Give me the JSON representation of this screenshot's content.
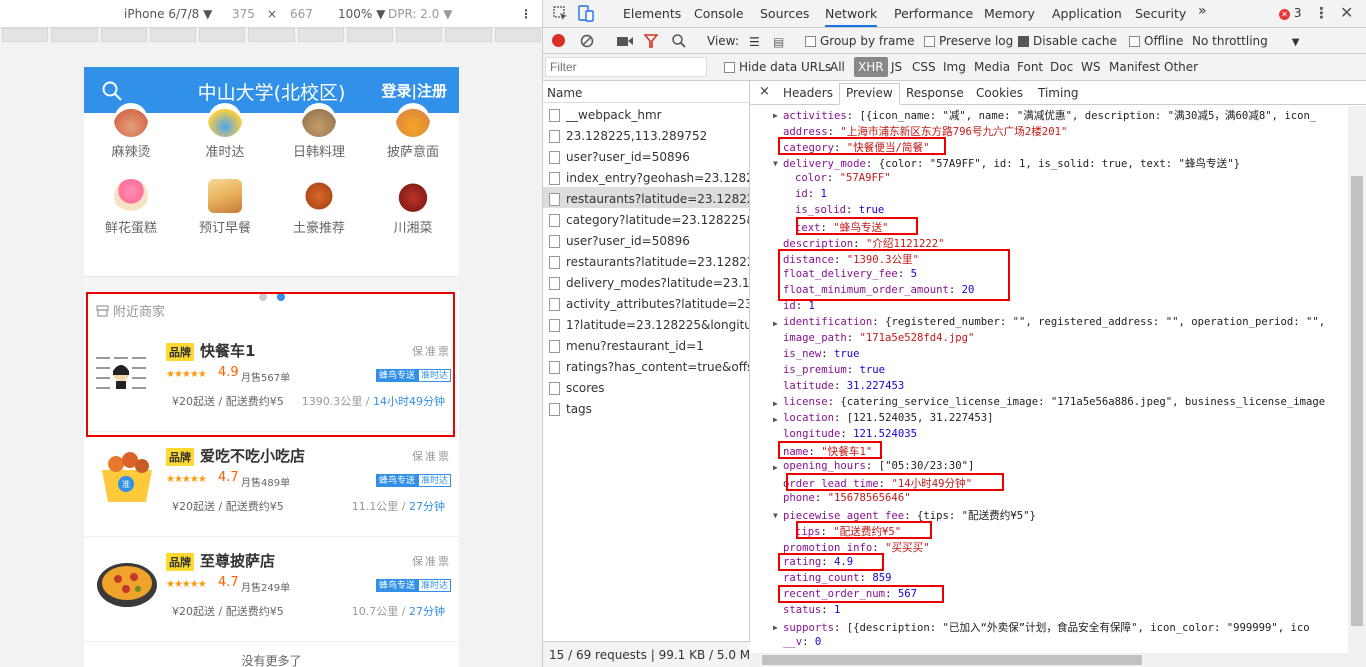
{
  "device_toolbar": {
    "device": "iPhone 6/7/8",
    "width": "375",
    "times": "×",
    "height": "667",
    "zoom": "100%",
    "dpr": "DPR: 2.0"
  },
  "phone": {
    "title": "中山大学(北校区)",
    "login": "登录|注册",
    "food_row1": [
      "麻辣烫",
      "准时达",
      "日韩料理",
      "披萨意面"
    ],
    "food_row2": [
      "鲜花蛋糕",
      "预订早餐",
      "土豪推荐",
      "川湘菜"
    ],
    "nearby_title": "附近商家",
    "brand_label": "品牌",
    "guarantee": "保准票",
    "tag_delivery": "蜂鸟专送",
    "tag_ontime": "准时达",
    "stars": "★★★★★",
    "shops": [
      {
        "name": "快餐车1",
        "rating": "4.9",
        "sold": "月售567单",
        "fee": "¥20起送 / 配送费约¥5",
        "distance": "1390.3公里",
        "time": "14小时49分钟"
      },
      {
        "name": "爱吃不吃小吃店",
        "rating": "4.7",
        "sold": "月售489单",
        "fee": "¥20起送 / 配送费约¥5",
        "distance": "11.1公里",
        "time": "27分钟"
      },
      {
        "name": "至尊披萨店",
        "rating": "4.7",
        "sold": "月售249单",
        "fee": "¥20起送 / 配送费约¥5",
        "distance": "10.7公里",
        "time": "27分钟"
      }
    ],
    "no_more": "没有更多了"
  },
  "devtools": {
    "tabs": [
      "Elements",
      "Console",
      "Sources",
      "Network",
      "Performance",
      "Memory",
      "Application",
      "Security"
    ],
    "more_tabs": "»",
    "error_count": "3",
    "controls": {
      "view": "View:",
      "group_by_frame": "Group by frame",
      "preserve_log": "Preserve log",
      "disable_cache": "Disable cache",
      "offline": "Offline",
      "throttling": "No throttling"
    },
    "filter": {
      "placeholder": "Filter",
      "hide_data_urls": "Hide data URLs",
      "types": [
        "All",
        "XHR",
        "JS",
        "CSS",
        "Img",
        "Media",
        "Font",
        "Doc",
        "WS",
        "Manifest",
        "Other"
      ]
    },
    "list_header": "Name",
    "requests": [
      "__webpack_hmr",
      "23.128225,113.289752",
      "user?user_id=50896",
      "index_entry?geohash=23.12822...",
      "restaurants?latitude=23.128225...",
      "category?latitude=23.128225&l...",
      "user?user_id=50896",
      "restaurants?latitude=23.128225...",
      "delivery_modes?latitude=23.12...",
      "activity_attributes?latitude=23.1...",
      "1?latitude=23.128225&longitud...",
      "menu?restaurant_id=1",
      "ratings?has_content=true&offse...",
      "scores",
      "tags"
    ],
    "status": "15 / 69 requests  |  99.1 KB / 5.0 MB ...",
    "detail_tabs": [
      "Headers",
      "Preview",
      "Response",
      "Cookies",
      "Timing"
    ],
    "close": "×"
  },
  "preview": [
    {
      "key": "activities",
      "val": "[{icon_name: \"减\", name: \"满减优惠\", description: \"满30减5，满60减8\", icon_",
      "type": "p",
      "arrow": "right",
      "indent": 0
    },
    {
      "key": "address",
      "val": "\"上海市浦东新区东方路796号九六广场2楼201\"",
      "type": "s",
      "indent": 0
    },
    {
      "key": "category",
      "val": "\"快餐便当/简餐\"",
      "type": "s",
      "indent": 0
    },
    {
      "key": "delivery_mode",
      "val": "{color: \"57A9FF\", id: 1, is_solid: true, text: \"蜂鸟专送\"}",
      "type": "p",
      "arrow": "down",
      "indent": 0
    },
    {
      "key": "color",
      "val": "\"57A9FF\"",
      "type": "s",
      "indent": 1
    },
    {
      "key": "id",
      "val": "1",
      "type": "n",
      "indent": 1
    },
    {
      "key": "is_solid",
      "val": "true",
      "type": "n",
      "indent": 1
    },
    {
      "key": "text",
      "val": "\"蜂鸟专送\"",
      "type": "s",
      "indent": 1
    },
    {
      "key": "description",
      "val": "\"介绍1121222\"",
      "type": "s",
      "indent": 0
    },
    {
      "key": "distance",
      "val": "\"1390.3公里\"",
      "type": "s",
      "indent": 0
    },
    {
      "key": "float_delivery_fee",
      "val": "5",
      "type": "n",
      "indent": 0
    },
    {
      "key": "float_minimum_order_amount",
      "val": "20",
      "type": "n",
      "indent": 0
    },
    {
      "key": "id",
      "val": "1",
      "type": "n",
      "indent": 0
    },
    {
      "key": "identification",
      "val": "{registered_number: \"\", registered_address: \"\", operation_period: \"\",",
      "type": "p",
      "arrow": "right",
      "indent": 0
    },
    {
      "key": "image_path",
      "val": "\"171a5e528fd4.jpg\"",
      "type": "s",
      "indent": 0
    },
    {
      "key": "is_new",
      "val": "true",
      "type": "n",
      "indent": 0
    },
    {
      "key": "is_premium",
      "val": "true",
      "type": "n",
      "indent": 0
    },
    {
      "key": "latitude",
      "val": "31.227453",
      "type": "n",
      "indent": 0
    },
    {
      "key": "license",
      "val": "{catering_service_license_image: \"171a5e56a886.jpeg\", business_license_image",
      "type": "p",
      "arrow": "right",
      "indent": 0
    },
    {
      "key": "location",
      "val": "[121.524035, 31.227453]",
      "type": "p",
      "arrow": "right",
      "indent": 0
    },
    {
      "key": "longitude",
      "val": "121.524035",
      "type": "n",
      "indent": 0
    },
    {
      "key": "name",
      "val": "\"快餐车1\"",
      "type": "s",
      "indent": 0
    },
    {
      "key": "opening_hours",
      "val": "[\"05:30/23:30\"]",
      "type": "p",
      "arrow": "right",
      "indent": 0
    },
    {
      "key": "order_lead_time",
      "val": "\"14小时49分钟\"",
      "type": "s",
      "indent": 0
    },
    {
      "key": "phone",
      "val": "\"15678565646\"",
      "type": "s",
      "indent": 0
    },
    {
      "key": "piecewise_agent_fee",
      "val": "{tips: \"配送费约¥5\"}",
      "type": "p",
      "arrow": "down",
      "indent": 0
    },
    {
      "key": "tips",
      "val": "\"配送费约¥5\"",
      "type": "s",
      "indent": 1
    },
    {
      "key": "promotion_info",
      "val": "\"买买买\"",
      "type": "s",
      "indent": 0
    },
    {
      "key": "rating",
      "val": "4.9",
      "type": "n",
      "indent": 0
    },
    {
      "key": "rating_count",
      "val": "859",
      "type": "n",
      "indent": 0
    },
    {
      "key": "recent_order_num",
      "val": "567",
      "type": "n",
      "indent": 0
    },
    {
      "key": "status",
      "val": "1",
      "type": "n",
      "indent": 0
    },
    {
      "key": "supports",
      "val": "[{description: \"已加入“外卖保”计划，食品安全有保障\", icon_color: \"999999\", ico",
      "type": "p",
      "arrow": "right",
      "indent": 0
    },
    {
      "key": "__v",
      "val": "0",
      "type": "n",
      "indent": 0
    }
  ]
}
